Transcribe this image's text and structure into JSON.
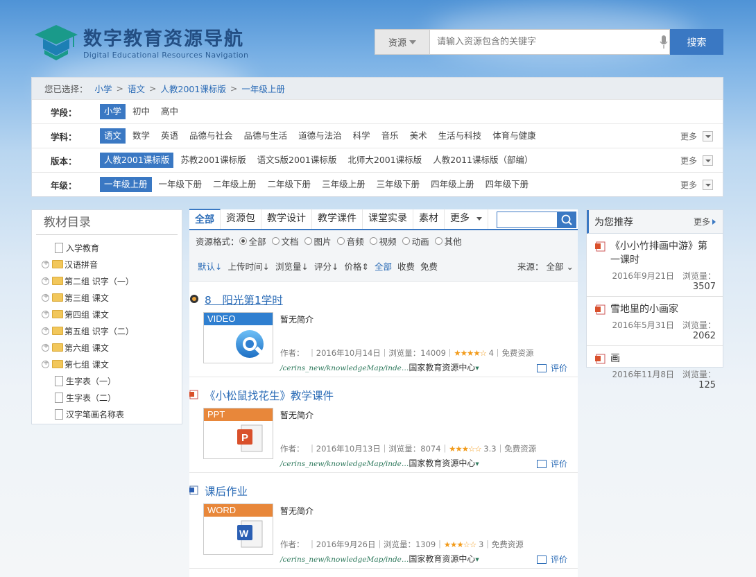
{
  "header": {
    "title_cn": "数字教育资源导航",
    "title_en": "Digital Educational Resources Navigation",
    "search": {
      "scope_label": "资源",
      "placeholder": "请输入资源包含的关键字",
      "button_label": "搜索"
    }
  },
  "breadcrumb": {
    "label": "您已选择：",
    "items": [
      "小学",
      "语文",
      "人教2001课标版",
      "一年级上册"
    ]
  },
  "filters": [
    {
      "label": "学段：",
      "options": [
        "小学",
        "初中",
        "高中"
      ],
      "selected": 0,
      "more": ""
    },
    {
      "label": "学科：",
      "options": [
        "语文",
        "数学",
        "英语",
        "品德与社会",
        "品德与生活",
        "道德与法治",
        "科学",
        "音乐",
        "美术",
        "生活与科技",
        "体育与健康"
      ],
      "selected": 0,
      "more": "更多"
    },
    {
      "label": "版本：",
      "options": [
        "人教2001课标版",
        "苏教2001课标版",
        "语文S版2001课标版",
        "北师大2001课标版",
        "人教2011课标版（部编）"
      ],
      "selected": 0,
      "more": "更多"
    },
    {
      "label": "年级：",
      "options": [
        "一年级上册",
        "一年级下册",
        "二年级上册",
        "二年级下册",
        "三年级上册",
        "三年级下册",
        "四年级上册",
        "四年级下册"
      ],
      "selected": 0,
      "more": "更多"
    }
  ],
  "catalog": {
    "title": "教材目录",
    "nodes": [
      {
        "label": "入学教育",
        "type": "doc"
      },
      {
        "label": "汉语拼音",
        "type": "folder"
      },
      {
        "label": "第二组 识字（一）",
        "type": "folder"
      },
      {
        "label": "第三组 课文",
        "type": "folder"
      },
      {
        "label": "第四组 课文",
        "type": "folder"
      },
      {
        "label": "第五组 识字（二）",
        "type": "folder"
      },
      {
        "label": "第六组 课文",
        "type": "folder"
      },
      {
        "label": "第七组 课文",
        "type": "folder"
      },
      {
        "label": "生字表（一）",
        "type": "doc"
      },
      {
        "label": "生字表（二）",
        "type": "doc"
      },
      {
        "label": "汉字笔画名称表",
        "type": "doc"
      }
    ]
  },
  "tabs": {
    "items": [
      "全部",
      "资源包",
      "教学设计",
      "教学课件",
      "课堂实录",
      "素材",
      "更多"
    ],
    "selected": 0
  },
  "format": {
    "label": "资源格式：",
    "options": [
      "全部",
      "文档",
      "图片",
      "音频",
      "视频",
      "动画",
      "其他"
    ],
    "selected": 0
  },
  "sort": {
    "items": [
      "默认",
      "上传时间",
      "浏览量",
      "评分",
      "价格"
    ],
    "price": [
      "全部",
      "收费",
      "免费"
    ],
    "source_label": "来源：",
    "source_value": "全部"
  },
  "results": [
    {
      "title": "8　阳光第1学时",
      "type": "VIDEO",
      "band_color": "#2f7fd0",
      "desc": "暂无简介",
      "author": "作者：",
      "date": "2016年10月14日",
      "views": "浏览量：14009",
      "stars": "★★★★☆",
      "rating": "4",
      "price": "免费资源",
      "url": "/cerins_new/knowledgeMap/inde…",
      "org": "国家教育资源中心",
      "eval": "评价"
    },
    {
      "title": "《小松鼠找花生》教学课件",
      "type": "PPT",
      "band_color": "#e8873a",
      "desc": "暂无简介",
      "author": "作者：",
      "date": "2016年10月13日",
      "views": "浏览量：8074",
      "stars": "★★★☆☆",
      "rating": "3.3",
      "price": "免费资源",
      "url": "/cerins_new/knowledgeMap/inde…",
      "org": "国家教育资源中心",
      "eval": "评价"
    },
    {
      "title": "课后作业",
      "type": "WORD",
      "band_color": "#e8873a",
      "desc": "暂无简介",
      "author": "作者：",
      "date": "2016年9月26日",
      "views": "浏览量：1309",
      "stars": "★★★☆☆",
      "rating": "3",
      "price": "免费资源",
      "url": "/cerins_new/knowledgeMap/inde…",
      "org": "国家教育资源中心",
      "eval": "评价"
    }
  ],
  "recommend": {
    "title": "为您推荐",
    "more": "更多",
    "items": [
      {
        "title": "《小小竹排画中游》第一课时",
        "date": "2016年9月21日",
        "views_label": "浏览量：",
        "views": "3507"
      },
      {
        "title": "雪地里的小画家",
        "date": "2016年5月31日",
        "views_label": "浏览量：",
        "views": "2062"
      },
      {
        "title": "画",
        "date": "2016年11月8日",
        "views_label": "浏览量：",
        "views": "125"
      }
    ]
  },
  "colors": {
    "accent": "#3a78c3",
    "link": "#2a6bb6",
    "star": "#f29b1b"
  }
}
